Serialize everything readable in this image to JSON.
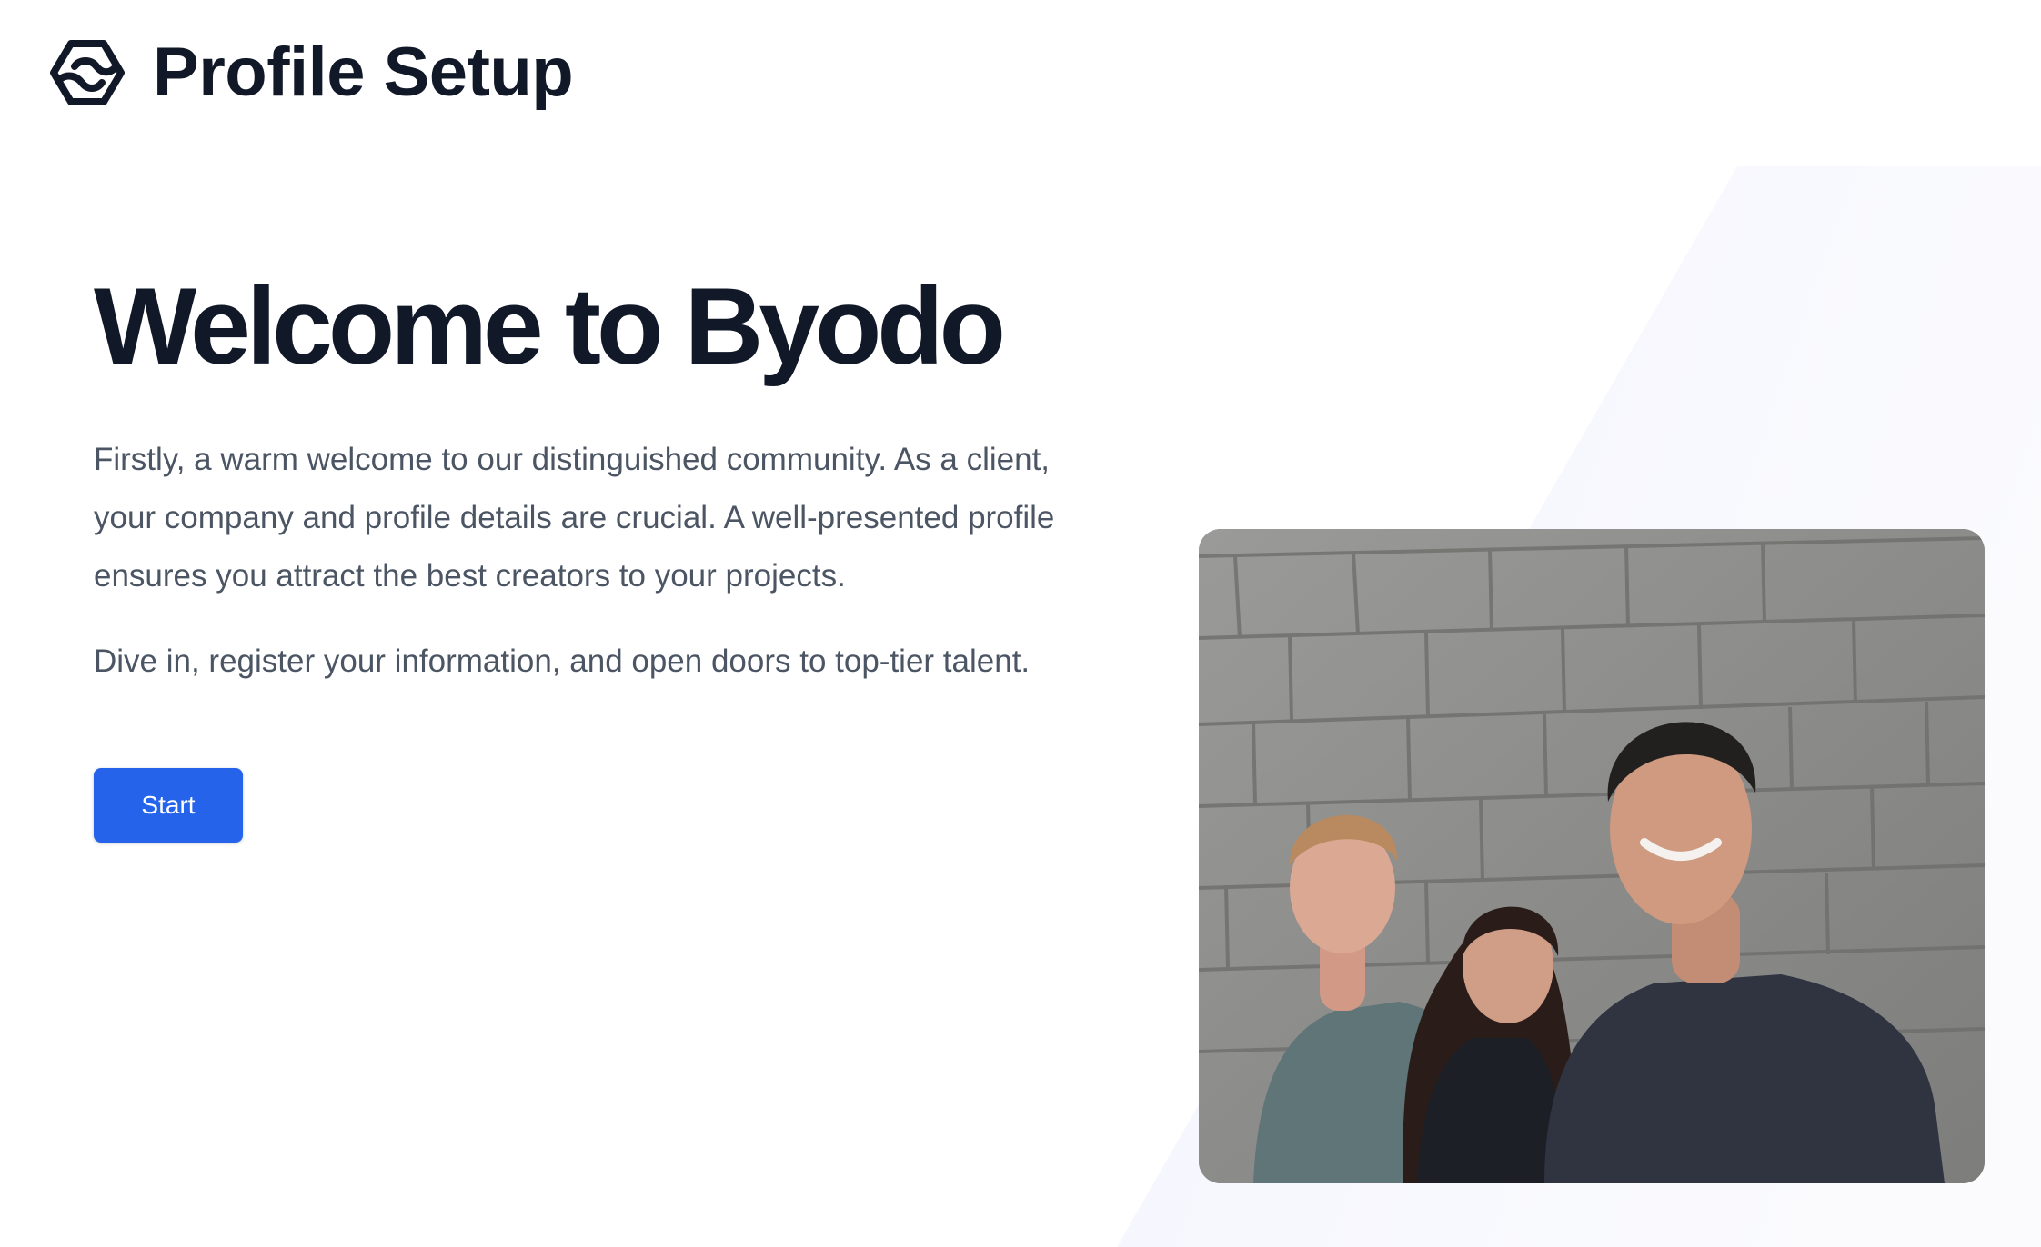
{
  "header": {
    "title": "Profile Setup",
    "logo_icon": "byodo-hexagon-logo-icon"
  },
  "hero": {
    "title": "Welcome to Byodo",
    "paragraph_1": "Firstly, a warm welcome to our distinguished community. As a client, your company and profile details are crucial. A well-presented profile ensures you attract the best creators to your projects.",
    "paragraph_2": "Dive in, register your information, and open doors to top-tier talent.",
    "start_button_label": "Start"
  },
  "photo": {
    "alt": "Three smiling team members standing in front of a gray brick wall"
  },
  "colors": {
    "primary": "#2563eb",
    "heading": "#111827",
    "body_text": "#4b5563",
    "background_tint": "#f8f9fe"
  }
}
